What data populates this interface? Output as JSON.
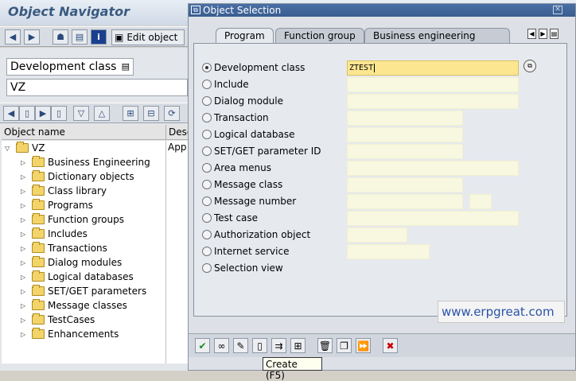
{
  "navigator": {
    "title": "Object Navigator",
    "display_object_label": "Edit object",
    "object_type": "Development class",
    "object_name": "VZ",
    "columns": [
      "Object name",
      "Desc"
    ],
    "root": {
      "label": "VZ",
      "desc": "App"
    },
    "items": [
      "Business Engineering",
      "Dictionary objects",
      "Class library",
      "Programs",
      "Function groups",
      "Includes",
      "Transactions",
      "Dialog modules",
      "Logical databases",
      "SET/GET parameters",
      "Message classes",
      "TestCases",
      "Enhancements"
    ]
  },
  "dialog": {
    "title": "Object Selection",
    "tabs": [
      "Program",
      "Function group",
      "Business engineering"
    ],
    "options": [
      {
        "label": "Development class",
        "selected": true
      },
      {
        "label": "Include",
        "selected": false
      },
      {
        "label": "Dialog module",
        "selected": false
      },
      {
        "label": "Transaction",
        "selected": false
      },
      {
        "label": "Logical database",
        "selected": false
      },
      {
        "label": "SET/GET parameter ID",
        "selected": false
      },
      {
        "label": "Area menus",
        "selected": false
      },
      {
        "label": "Message class",
        "selected": false
      },
      {
        "label": "Message number",
        "selected": false
      },
      {
        "label": "Test case",
        "selected": false
      },
      {
        "label": "Authorization object",
        "selected": false
      },
      {
        "label": "Internet service",
        "selected": false
      },
      {
        "label": "Selection view",
        "selected": false
      }
    ],
    "development_class_value": "ZTEST",
    "tooltip": "Create    (F5)"
  },
  "watermark": "www.erpgreat.com",
  "colors": {
    "title_bar": "#3a5d90",
    "active_field": "#fde690",
    "cancel_icon": "#cc0000"
  }
}
